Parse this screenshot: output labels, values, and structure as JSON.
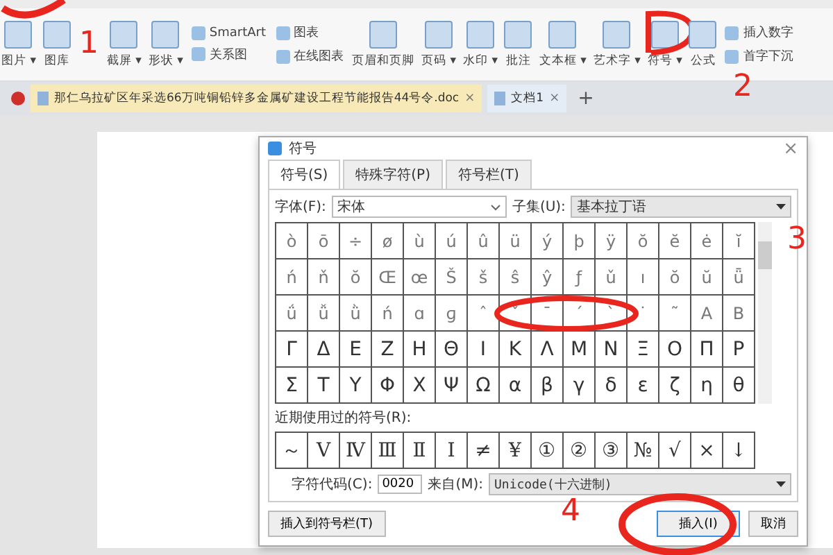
{
  "ribbon": {
    "columns": [
      {
        "kind": "large",
        "items": [
          {
            "label": "图片 ▾"
          }
        ]
      },
      {
        "kind": "large",
        "items": [
          {
            "label": "图库"
          }
        ]
      },
      {
        "kind": "large",
        "items": [
          {
            "label": "截屏 ▾"
          }
        ]
      },
      {
        "kind": "large",
        "items": [
          {
            "label": "形状 ▾"
          }
        ]
      },
      {
        "kind": "stack",
        "items": [
          {
            "label": "SmartArt"
          },
          {
            "label": "关系图"
          }
        ]
      },
      {
        "kind": "stack",
        "items": [
          {
            "label": "图表"
          },
          {
            "label": "在线图表"
          }
        ]
      },
      {
        "kind": "large",
        "items": [
          {
            "label": "页眉和页脚"
          }
        ]
      },
      {
        "kind": "large",
        "items": [
          {
            "label": "页码 ▾"
          }
        ]
      },
      {
        "kind": "large",
        "items": [
          {
            "label": "水印 ▾"
          }
        ]
      },
      {
        "kind": "large",
        "items": [
          {
            "label": "批注"
          }
        ]
      },
      {
        "kind": "large",
        "items": [
          {
            "label": "文本框 ▾"
          }
        ]
      },
      {
        "kind": "large",
        "items": [
          {
            "label": "艺术字 ▾"
          }
        ]
      },
      {
        "kind": "large",
        "marked": true,
        "items": [
          {
            "label": "符号 ▾"
          }
        ]
      },
      {
        "kind": "large",
        "items": [
          {
            "label": "公式"
          }
        ]
      },
      {
        "kind": "stack",
        "items": [
          {
            "label": "插入数字"
          },
          {
            "label": "首字下沉"
          }
        ]
      }
    ]
  },
  "doc_tabs": [
    {
      "title": "那仁乌拉矿区年采选66万吨铜铅锌多金属矿建设工程节能报告44号令.doc",
      "close": "×",
      "selected": true
    },
    {
      "title": "文档1",
      "close": "×",
      "selected": false
    }
  ],
  "new_tab": "+",
  "dialog": {
    "title": "符号",
    "close": "×",
    "tabs": [
      {
        "label": "符号(S)",
        "selected": true
      },
      {
        "label": "特殊字符(P)",
        "selected": false
      },
      {
        "label": "符号栏(T)",
        "selected": false
      }
    ],
    "font_label": "字体(F):",
    "font_value": "宋体",
    "subset_label": "子集(U):",
    "subset_value": "基本拉丁语",
    "grid": [
      [
        "ò",
        "ō",
        "÷",
        "ø",
        "ù",
        "ú",
        "û",
        "ü",
        "ý",
        "þ",
        "ÿ",
        "ŏ",
        "ĕ",
        "ė",
        "ĭ"
      ],
      [
        "ń",
        "ň",
        "ŏ",
        "Œ",
        "œ",
        "Š",
        "š",
        "ŝ",
        "ŷ",
        "ƒ",
        "ǔ",
        "ı",
        "ŏ",
        "ŭ",
        "ǖ"
      ],
      [
        "ǘ",
        "ǚ",
        "ǜ",
        "ń",
        "ɑ",
        "ɡ",
        "ˆ",
        "ˇ",
        "ˉ",
        "ˊ",
        "ˋ",
        "˙",
        "˜",
        "Α",
        "Β"
      ],
      [
        "Γ",
        "Δ",
        "Ε",
        "Ζ",
        "Η",
        "Θ",
        "Ι",
        "Κ",
        "Λ",
        "Μ",
        "Ν",
        "Ξ",
        "Ο",
        "Π",
        "Ρ"
      ],
      [
        "Σ",
        "Τ",
        "Υ",
        "Φ",
        "Χ",
        "Ψ",
        "Ω",
        "α",
        "β",
        "γ",
        "δ",
        "ε",
        "ζ",
        "η",
        "θ"
      ]
    ],
    "recent_label": "近期使用过的符号(R):",
    "recent": [
      "～",
      "Ⅴ",
      "Ⅳ",
      "Ⅲ",
      "Ⅱ",
      "Ⅰ",
      "≠",
      "¥",
      "①",
      "②",
      "③",
      "№",
      "√",
      "×",
      "↓"
    ],
    "code_label": "字符代码(C):",
    "code_value": "0020",
    "from_label": "来自(M):",
    "from_value": "Unicode(十六进制)",
    "buttons": [
      {
        "label": "插入到符号栏(T)",
        "kind": "plain"
      },
      {
        "label": "插入(I)",
        "kind": "default"
      },
      {
        "label": "取消",
        "kind": "plain"
      }
    ]
  },
  "annotations": [
    "1",
    "2",
    "3",
    "4"
  ]
}
